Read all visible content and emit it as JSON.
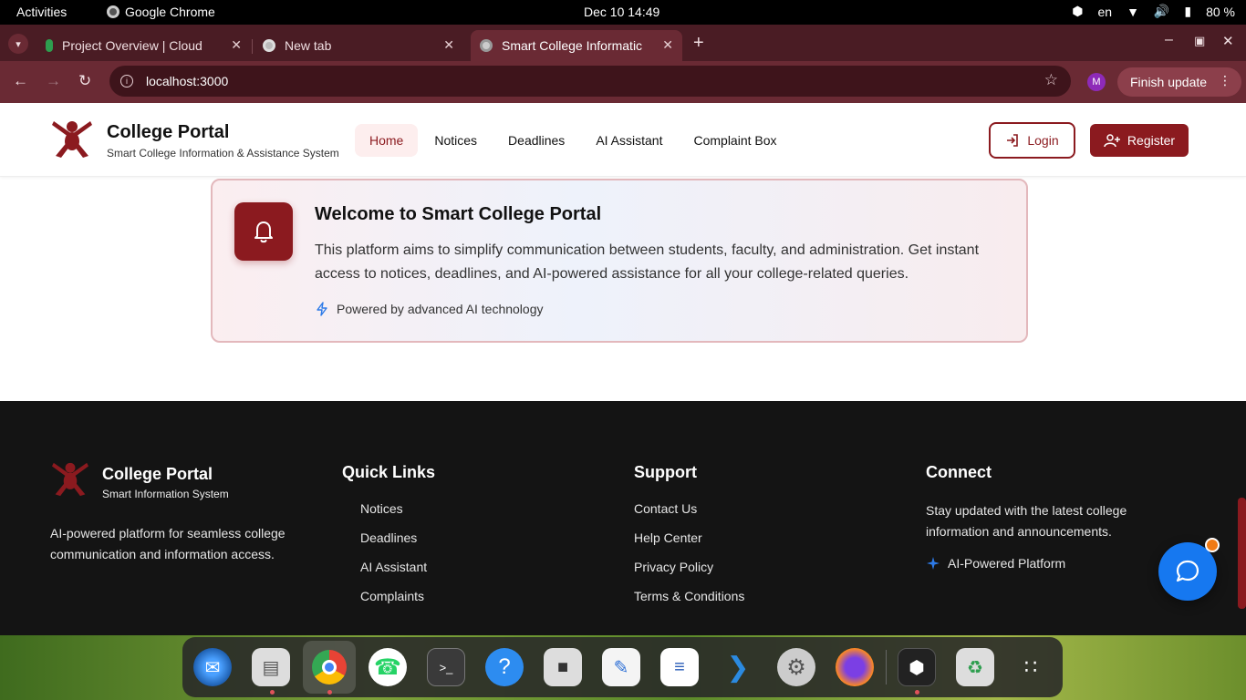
{
  "system_bar": {
    "activities": "Activities",
    "app_name": "Google Chrome",
    "clock": "Dec 10  14:49",
    "lang": "en",
    "battery": "80 %"
  },
  "tabs": [
    {
      "title": "Project Overview | Cloud",
      "active": false
    },
    {
      "title": "New tab",
      "active": false
    },
    {
      "title": "Smart College Informatic",
      "active": true
    }
  ],
  "toolbar": {
    "url": "localhost:3000",
    "profile_initial": "M",
    "finish_update": "Finish update"
  },
  "site": {
    "brand": "College Portal",
    "brand_sub": "Smart College Information & Assistance System",
    "nav": [
      "Home",
      "Notices",
      "Deadlines",
      "AI Assistant",
      "Complaint Box"
    ],
    "login": "Login",
    "register": "Register",
    "accent": "#8b1a1f"
  },
  "welcome": {
    "title": "Welcome to Smart College Portal",
    "body": "This platform aims to simplify communication between students, faculty, and administration. Get instant access to notices, deadlines, and AI-powered assistance for all your college-related queries.",
    "powered": "Powered by advanced AI technology"
  },
  "footer": {
    "brand": "College Portal",
    "brand_sub": "Smart Information System",
    "desc": "AI-powered platform for seamless college communication and information access.",
    "quick_links_title": "Quick Links",
    "quick_links": [
      "Notices",
      "Deadlines",
      "AI Assistant",
      "Complaints"
    ],
    "support_title": "Support",
    "support": [
      "Contact Us",
      "Help Center",
      "Privacy Policy",
      "Terms & Conditions"
    ],
    "connect_title": "Connect",
    "connect_text": "Stay updated with the latest college information and announcements.",
    "connect_ai": "AI-Powered Platform"
  },
  "dock": [
    "thunderbird-icon",
    "files-icon",
    "chrome-icon",
    "whatsapp-icon",
    "terminal-icon",
    "help-icon",
    "notes-icon",
    "text-editor-icon",
    "writer-icon",
    "vscode-icon",
    "settings-icon",
    "firefox-icon",
    "cube-icon",
    "trash-icon",
    "app-grid-icon"
  ]
}
